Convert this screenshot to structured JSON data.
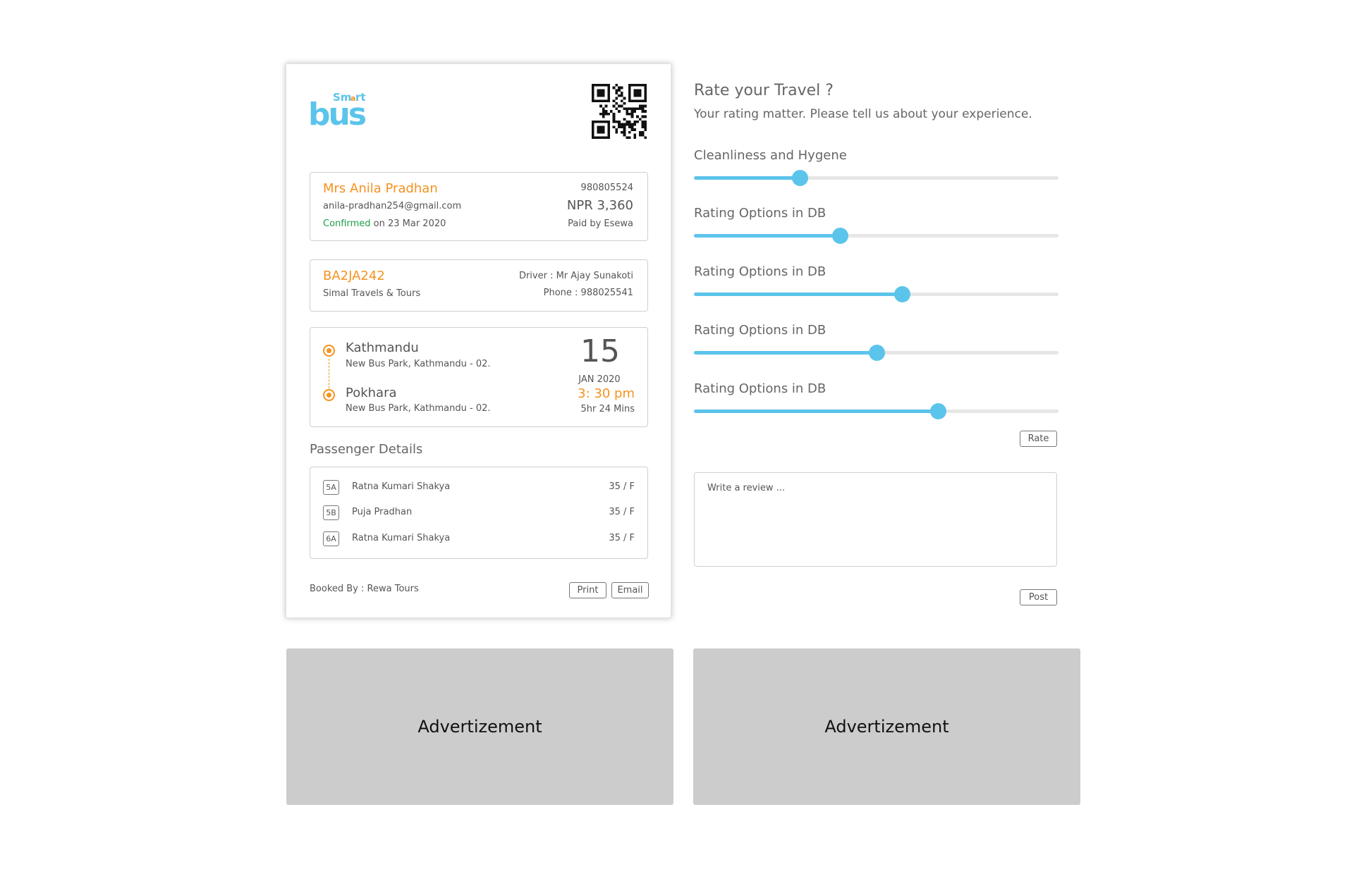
{
  "ticket": {
    "logo_text": "Smart bus",
    "passenger": {
      "name": "Mrs Anila Pradhan",
      "email": "anila-pradhan254@gmail.com",
      "status": "Confirmed",
      "date": "on 23 Mar 2020",
      "phone": "980805524",
      "amount": "NPR 3,360",
      "paid_by": "Paid by Esewa"
    },
    "bus": {
      "number": "BA2JA242",
      "operator": "Simal Travels & Tours",
      "driver": "Driver : Mr Ajay Sunakoti",
      "phone": "Phone : 988025541"
    },
    "route": {
      "from_city": "Kathmandu",
      "from_address": "New Bus Park, Kathmandu - 02.",
      "to_city": "Pokhara",
      "to_address": "New Bus Park, Kathmandu - 02.",
      "day": "15",
      "month_year": "JAN 2020",
      "time": "3: 30 pm",
      "duration": "5hr 24 Mins"
    },
    "passenger_details_title": "Passenger Details",
    "passengers": [
      {
        "seat": "5A",
        "name": "Ratna Kumari Shakya",
        "age_sex": "35 / F"
      },
      {
        "seat": "5B",
        "name": "Puja Pradhan",
        "age_sex": "35 / F"
      },
      {
        "seat": "6A",
        "name": "Ratna Kumari Shakya",
        "age_sex": "35 / F"
      }
    ],
    "booked_by": "Booked By : Rewa Tours",
    "print_label": "Print",
    "email_label": "Email"
  },
  "rating": {
    "title": "Rate your Travel ?",
    "subtitle": "Your rating matter. Please tell us about your experience.",
    "sliders": [
      {
        "label": "Cleanliness and Hygene",
        "value": 0.29
      },
      {
        "label": "Rating Options in DB",
        "value": 0.4
      },
      {
        "label": "Rating Options in DB",
        "value": 0.57
      },
      {
        "label": "Rating Options in DB",
        "value": 0.5
      },
      {
        "label": "Rating Options in DB",
        "value": 0.67
      }
    ],
    "rate_label": "Rate",
    "review_placeholder": "Write a review ...",
    "post_label": "Post"
  },
  "ads": [
    "Advertizement",
    "Advertizement"
  ],
  "colors": {
    "accent_blue": "#5bc4ea",
    "accent_orange": "#f5921f",
    "confirmed_green": "#1e9e4a",
    "ad_gray": "#cccccc"
  }
}
